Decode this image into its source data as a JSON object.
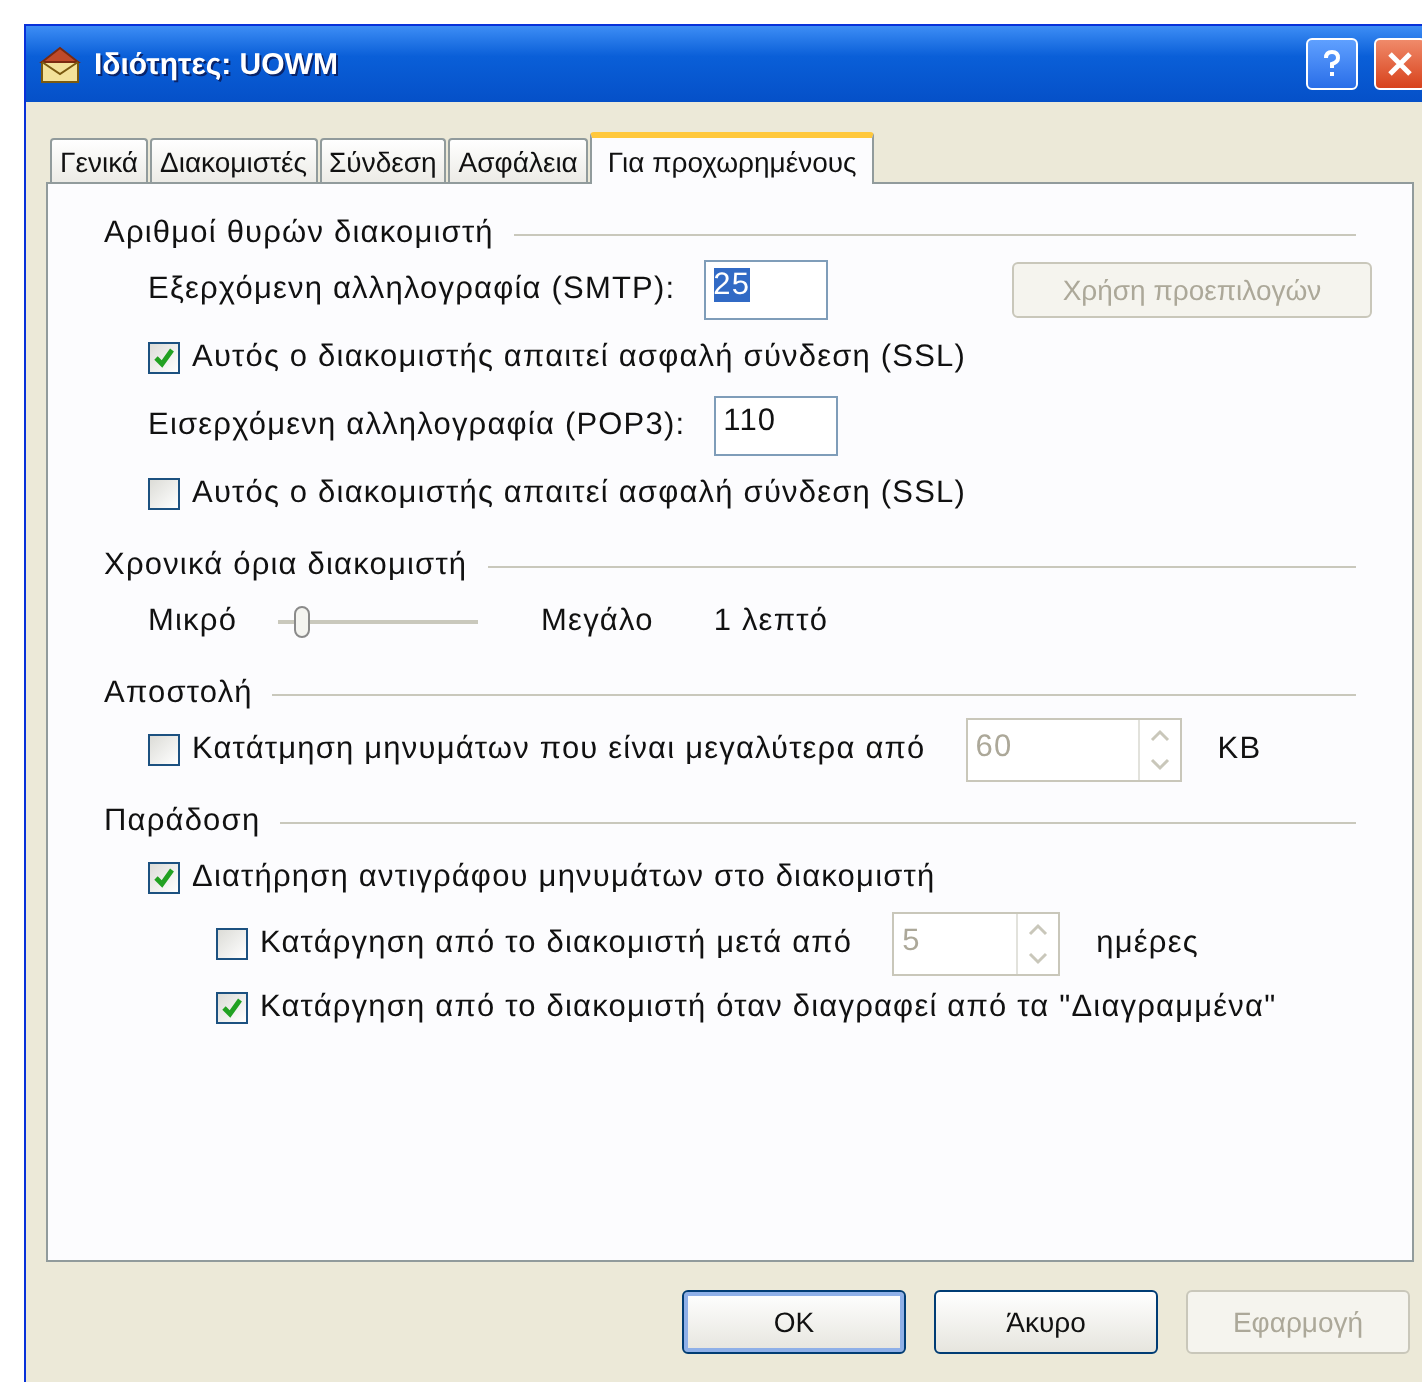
{
  "window": {
    "title": "Ιδιότητες: UOWM"
  },
  "tabs": [
    {
      "label": "Γενικά",
      "selected": false
    },
    {
      "label": "Διακομιστές",
      "selected": false
    },
    {
      "label": "Σύνδεση",
      "selected": false
    },
    {
      "label": "Ασφάλεια",
      "selected": false
    },
    {
      "label": "Για προχωρημένους",
      "selected": true
    }
  ],
  "sections": [
    {
      "title": "Αριθμοί θυρών διακομιστή",
      "rows": [
        {
          "kind": "field",
          "label": "Εξερχόμενη αλληλογραφία (SMTP):",
          "value": "25",
          "text_selected": true,
          "button": {
            "label": "Χρήση προεπιλογών",
            "disabled": true
          }
        },
        {
          "kind": "checkbox",
          "label": "Αυτός ο διακομιστής απαιτεί ασφαλή σύνδεση (SSL)",
          "checked": true
        },
        {
          "kind": "field",
          "label": "Εισερχόμενη αλληλογραφία (POP3):",
          "value": "110",
          "text_selected": false
        },
        {
          "kind": "checkbox",
          "label": "Αυτός ο διακομιστής απαιτεί ασφαλή σύνδεση (SSL)",
          "checked": false
        }
      ]
    },
    {
      "title": "Χρονικά όρια διακομιστή",
      "rows": [
        {
          "kind": "slider",
          "min_label": "Μικρό",
          "max_label": "Μεγάλο",
          "level": 0.12,
          "reading": "1 λεπτό"
        }
      ]
    },
    {
      "title": "Αποστολή",
      "rows": [
        {
          "kind": "spin",
          "label": "Κατάτμηση μηνυμάτων που είναι μεγαλύτερα από",
          "checked": false,
          "value": "60",
          "disabled": true,
          "unit": "KB"
        }
      ]
    },
    {
      "title": "Παράδοση",
      "rows": [
        {
          "kind": "checkbox",
          "label": "Διατήρηση αντιγράφου μηνυμάτων στο διακομιστή",
          "checked": true,
          "children": [
            {
              "kind": "spin",
              "label": "Κατάργηση από το διακομιστή μετά από",
              "checked": false,
              "value": "5",
              "disabled": true,
              "unit": "ημέρες"
            },
            {
              "kind": "checkbox",
              "label": "Κατάργηση από το διακομιστή όταν διαγραφεί από τα \"Διαγραμμένα\"",
              "checked": true
            }
          ]
        }
      ]
    }
  ],
  "buttons": [
    {
      "label": "OK",
      "default": true,
      "disabled": false
    },
    {
      "label": "Άκυρο",
      "default": false,
      "disabled": false
    },
    {
      "label": "Εφαρμογή",
      "default": false,
      "disabled": true
    }
  ]
}
